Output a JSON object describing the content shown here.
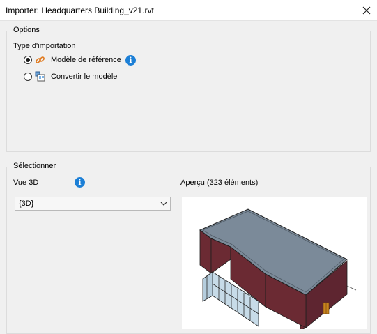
{
  "window": {
    "title": "Importer: Headquarters Building_v21.rvt"
  },
  "options": {
    "legend": "Options",
    "import_type_label": "Type d'importation",
    "radio_reference": {
      "label": "Modèle de référence",
      "checked": true
    },
    "radio_convert": {
      "label": "Convertir le modèle",
      "checked": false
    }
  },
  "select_group": {
    "legend": "Sélectionner",
    "view_label": "Vue 3D",
    "view_value": "{3D}",
    "preview_label": "Aperçu (323 éléments)"
  },
  "colors": {
    "info_blue": "#1c7fd6",
    "link_orange": "#e07a1f",
    "roof": "#7b8a99",
    "wall": "#6b2a33",
    "glass": "#c7dbe8"
  },
  "icons": {
    "close": "close-icon",
    "link": "link-icon",
    "convert": "convert-model-icon",
    "info": "info-icon",
    "chevron": "chevron-down-icon"
  }
}
